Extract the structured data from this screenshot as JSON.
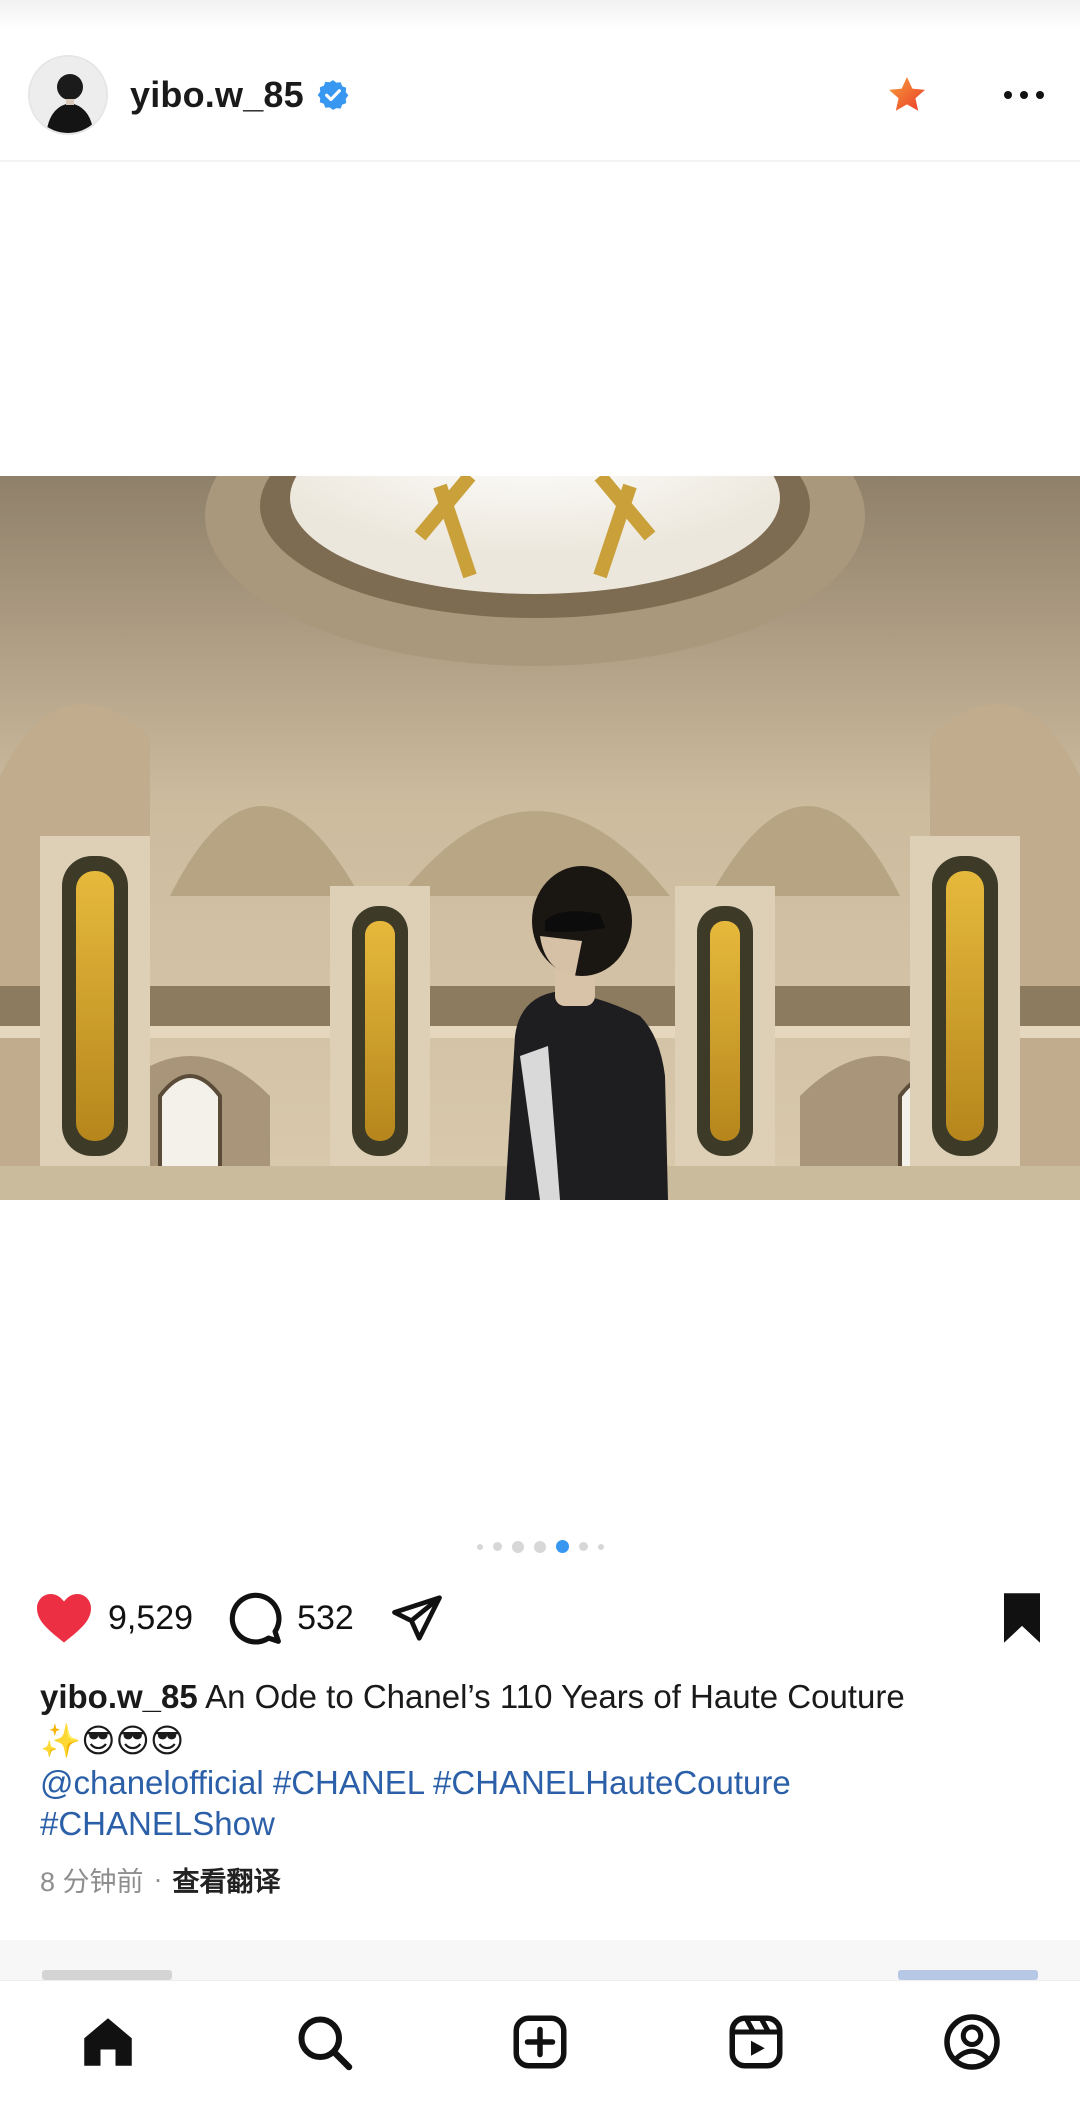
{
  "header": {
    "username": "yibo.w_85",
    "verified": true,
    "icons": [
      "avatar",
      "verified-badge-icon",
      "favorite-star-icon",
      "more-options-icon"
    ],
    "colors": {
      "verified": "#3897f0",
      "star": "#f0542c"
    }
  },
  "media": {
    "carousel_total": 7,
    "carousel_active_index": 4
  },
  "actions": {
    "likes": "9,529",
    "comments": "532",
    "liked": true,
    "saved": true,
    "colors": {
      "like": "#ed2f43"
    }
  },
  "caption": {
    "username": "yibo.w_85",
    "text": " An Ode to Chanel’s 110 Years of Haute Couture",
    "emojis": "✨😎😎😎",
    "mention": "@chanelofficial",
    "hashtags": [
      "#CHANEL",
      "#CHANELHauteCouture",
      "#CHANELShow"
    ]
  },
  "meta": {
    "time": "8 分钟前",
    "separator": "·",
    "translate": "查看翻译"
  },
  "tabbar": {
    "items": [
      "home-icon",
      "search-icon",
      "create-icon",
      "reels-icon",
      "profile-icon"
    ]
  }
}
